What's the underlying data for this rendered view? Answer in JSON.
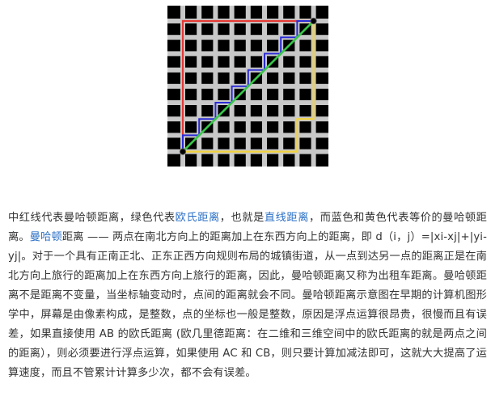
{
  "figure": {
    "alt_colors": {
      "background": "#000000",
      "grid": "#c8c8c8",
      "red": "#e53935",
      "blue": "#2b2bd6",
      "green": "#39c84a",
      "yellow": "#f2d23a"
    }
  },
  "article": {
    "p1_a": "中红线代表曼哈顿距离，绿色代表",
    "link_euclid": "欧氏距离",
    "p1_b": "，也就是",
    "link_straight": "直线距离",
    "p1_c": "，而蓝色和黄色代表等价的曼哈顿距离。",
    "link_manhattan": "曼哈顿",
    "p1_d": "距离 —— 两点在南北方向上的距离加上在东西方向上的距离，即 d（i，j）=|xi-xj|+|yi-yj|。对于一个具有正南正北、正东正西方向规则布局的城镇街道，从一点到达另一点的距离正是在南北方向上旅行的距离加上在东西方向上旅行的距离，因此，曼哈顿距离又称为出租车距离。曼哈顿距离不是距离不变量，当坐标轴变动时，点间的距离就会不同。曼哈顿距离示意图在早期的计算机图形学中，屏幕是由像素构成，是整数，点的坐标也一般是整数，原因是浮点运算很昂贵，很慢而且有误差，如果直接使用 AB 的欧氏距离 (欧几里德距离：在二维和三维空间中的欧氏距离的就是两点之间的距离），则必须要进行浮点运算，如果使用 AC 和 CB，则只要计算加减法即可，这就大大提高了运算速度，而且不管累计计算多少次，都不会有误差。"
  }
}
